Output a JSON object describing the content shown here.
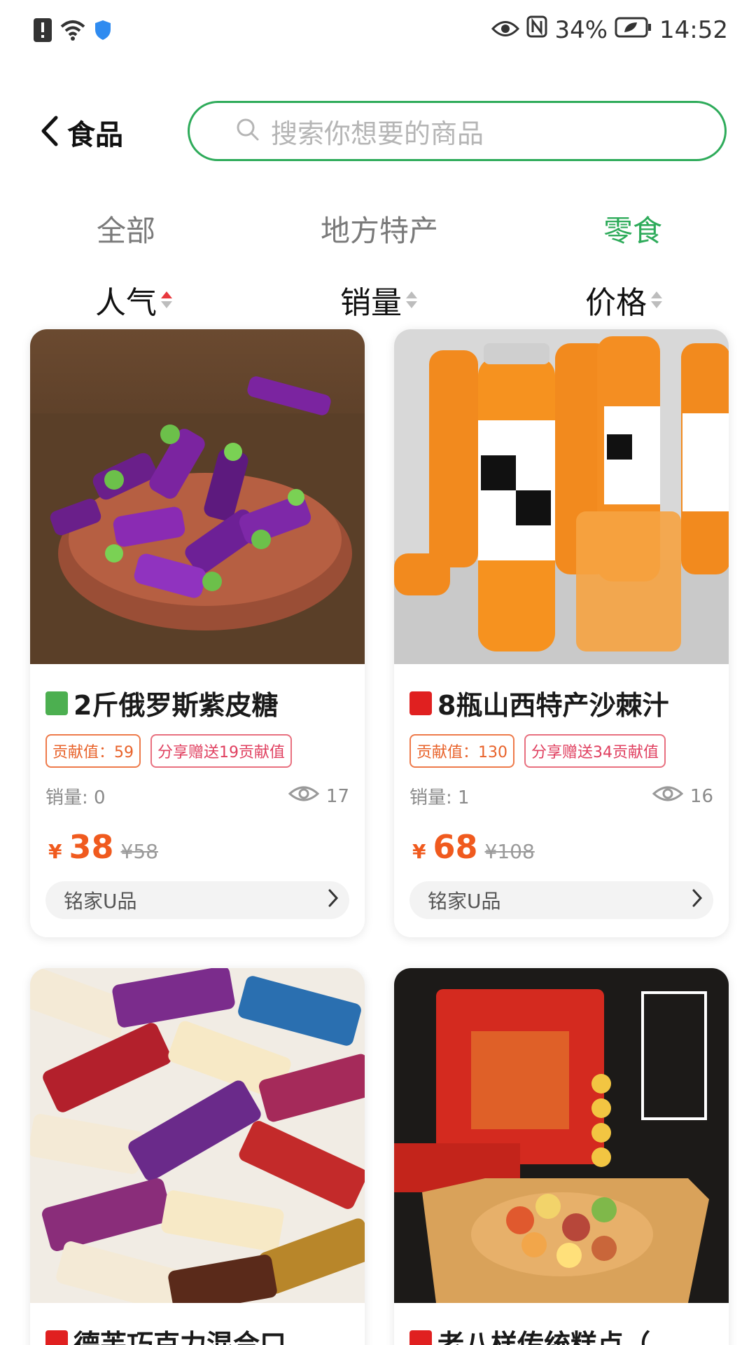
{
  "status_bar": {
    "battery_percent": "34%",
    "time": "14:52",
    "icons": [
      "alert-icon",
      "wifi-icon",
      "shield-icon",
      "eye-icon",
      "nfc-icon",
      "battery-icon"
    ]
  },
  "header": {
    "title": "食品",
    "search_placeholder": "搜索你想要的商品",
    "accent": "#2eab5a"
  },
  "tabs": [
    {
      "label": "全部",
      "active": false
    },
    {
      "label": "地方特产",
      "active": false
    },
    {
      "label": "零食",
      "active": true
    }
  ],
  "sorts": [
    {
      "label": "人气",
      "active": true
    },
    {
      "label": "销量",
      "active": false
    },
    {
      "label": "价格",
      "active": false
    }
  ],
  "products": [
    {
      "title": "2斤俄罗斯紫皮糖",
      "badge_color": "#4caf50",
      "tag1": "贡献值：59",
      "tag2": "分享赠送19贡献值",
      "sales": "销量: 0",
      "views": "17",
      "currency": "¥",
      "price": "38",
      "original_price": "¥58",
      "shop": "铭家U品"
    },
    {
      "title": "8瓶山西特产沙棘汁",
      "badge_color": "#e02020",
      "tag1": "贡献值：130",
      "tag2": "分享赠送34贡献值",
      "sales": "销量: 1",
      "views": "16",
      "currency": "¥",
      "price": "68",
      "original_price": "¥108",
      "shop": "铭家U品"
    },
    {
      "title": "德芙巧克力混合口…",
      "badge_color": "#e02020"
    },
    {
      "title": "老八样传统糕点（…",
      "badge_color": "#e02020"
    }
  ]
}
